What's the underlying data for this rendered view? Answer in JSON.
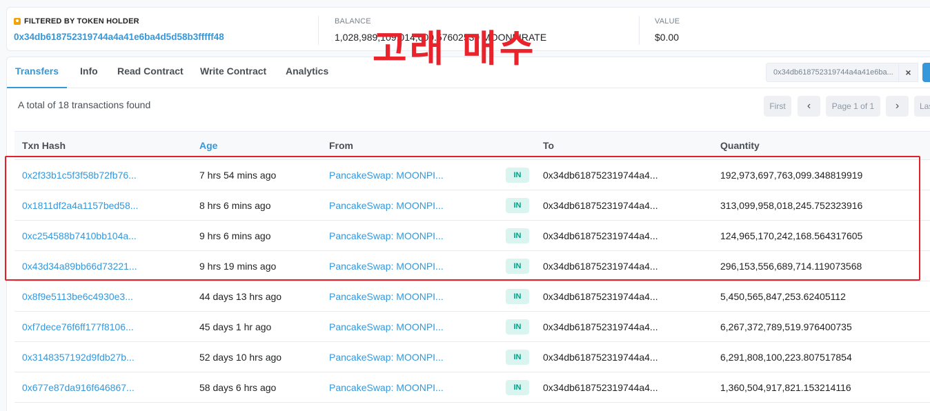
{
  "summary": {
    "filter_label": "FILTERED BY TOKEN HOLDER",
    "holder_address": "0x34db618752319744a4a41e6ba4d5d58b3fffff48",
    "balance_label": "BALANCE",
    "balance_value": "1,028,989,109,014,600.57602539 MOONPIRATE",
    "value_label": "VALUE",
    "value_value": "$0.00"
  },
  "tabs": [
    {
      "label": "Transfers",
      "active": true
    },
    {
      "label": "Info"
    },
    {
      "label": "Read Contract"
    },
    {
      "label": "Write Contract"
    },
    {
      "label": "Analytics"
    }
  ],
  "filter": {
    "value": "0x34db618752319744a4a41e6ba...",
    "clear_icon": "×"
  },
  "total_text": "A total of 18 transactions found",
  "annotation_text": "고래 매수",
  "pagination": {
    "first": "First",
    "prev": "‹",
    "info": "Page 1 of 1",
    "next": "›",
    "last": "Last"
  },
  "table": {
    "columns": [
      "Txn Hash",
      "Age",
      "From",
      "To",
      "Quantity"
    ],
    "direction_badge": "IN",
    "rows": [
      {
        "hash": "0x2f33b1c5f3f58b72fb76...",
        "age": "7 hrs 54 mins ago",
        "from": "PancakeSwap: MOONPI...",
        "to": "0x34db618752319744a4...",
        "qty": "192,973,697,763,099.348819919"
      },
      {
        "hash": "0x1811df2a4a1157bed58...",
        "age": "8 hrs 6 mins ago",
        "from": "PancakeSwap: MOONPI...",
        "to": "0x34db618752319744a4...",
        "qty": "313,099,958,018,245.752323916"
      },
      {
        "hash": "0xc254588b7410bb104a...",
        "age": "9 hrs 6 mins ago",
        "from": "PancakeSwap: MOONPI...",
        "to": "0x34db618752319744a4...",
        "qty": "124,965,170,242,168.564317605"
      },
      {
        "hash": "0x43d34a89bb66d73221...",
        "age": "9 hrs 19 mins ago",
        "from": "PancakeSwap: MOONPI...",
        "to": "0x34db618752319744a4...",
        "qty": "296,153,556,689,714.119073568"
      },
      {
        "hash": "0x8f9e5113be6c4930e3...",
        "age": "44 days 13 hrs ago",
        "from": "PancakeSwap: MOONPI...",
        "to": "0x34db618752319744a4...",
        "qty": "5,450,565,847,253.62405112"
      },
      {
        "hash": "0xf7dece76f6ff177f8106...",
        "age": "45 days 1 hr ago",
        "from": "PancakeSwap: MOONPI...",
        "to": "0x34db618752319744a4...",
        "qty": "6,267,372,789,519.976400735"
      },
      {
        "hash": "0x3148357192d9fdb27b...",
        "age": "52 days 10 hrs ago",
        "from": "PancakeSwap: MOONPI...",
        "to": "0x34db618752319744a4...",
        "qty": "6,291,808,100,223.807517854"
      },
      {
        "hash": "0x677e87da916f646867...",
        "age": "58 days 6 hrs ago",
        "from": "PancakeSwap: MOONPI...",
        "to": "0x34db618752319744a4...",
        "qty": "1,360,504,917,821.153214116"
      }
    ]
  },
  "colors": {
    "link": "#3498db",
    "annotation": "#e8232c",
    "badge_bg": "#daf4ef",
    "badge_text": "#00a186"
  }
}
